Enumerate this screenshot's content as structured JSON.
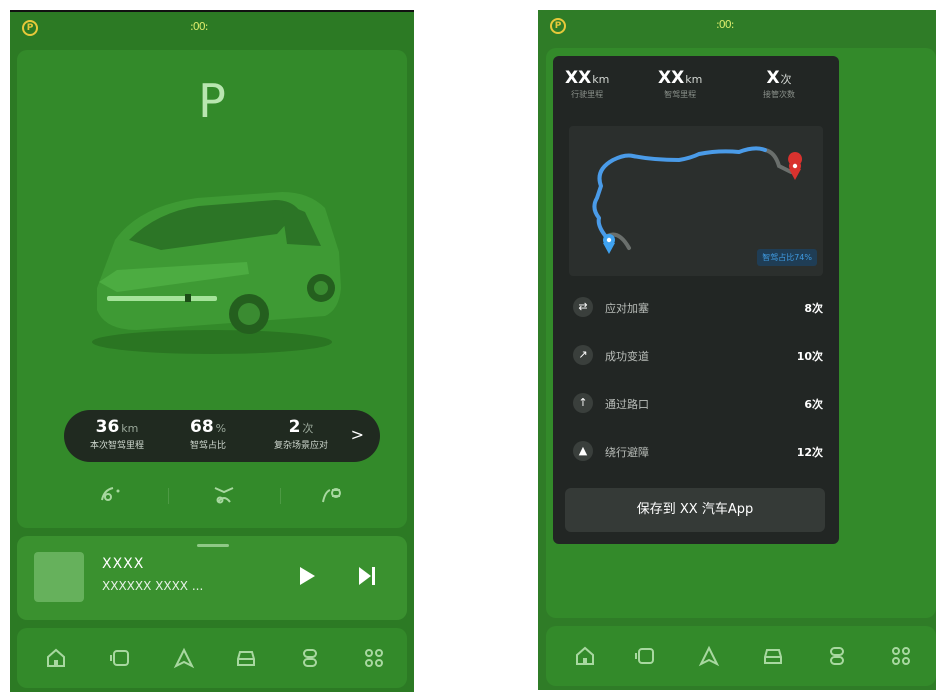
{
  "status": {
    "park_icon": "P",
    "light_icon": ":00:"
  },
  "left": {
    "gear": "P",
    "stats": [
      {
        "value": "36",
        "unit": "km",
        "label": "本次智驾里程"
      },
      {
        "value": "68",
        "unit": "%",
        "label": "智驾占比"
      },
      {
        "value": "2",
        "unit": "次",
        "label": "复杂场景应对"
      }
    ],
    "stats_chevron": ">",
    "features": [
      "steering-assist-icon",
      "auto-park-icon",
      "lane-assist-icon"
    ],
    "media": {
      "title": "XXXX",
      "subtitle": "XXXXXX XXXX ..."
    }
  },
  "dock": {
    "icons": [
      "home-icon",
      "media-icon",
      "navigation-icon",
      "car-icon",
      "control-icon",
      "apps-icon"
    ]
  },
  "right": {
    "top_stats": [
      {
        "value": "XX",
        "unit": "km",
        "label": "行驶里程"
      },
      {
        "value": "XX",
        "unit": "km",
        "label": "智驾里程"
      },
      {
        "value": "X",
        "unit": "次",
        "label": "接管次数"
      }
    ],
    "map": {
      "badge": "智驾占比74%",
      "smart_ratio": 0.74
    },
    "rows": [
      {
        "icon": "traffic-jam-icon",
        "label": "应对加塞",
        "value": "8次"
      },
      {
        "icon": "lane-change-icon",
        "label": "成功变道",
        "value": "10次"
      },
      {
        "icon": "intersection-icon",
        "label": "通过路口",
        "value": "6次"
      },
      {
        "icon": "obstacle-icon",
        "label": "绕行避障",
        "value": "12次"
      }
    ],
    "save_button": "保存到 XX 汽车App"
  },
  "colors": {
    "overlay_green": "#2c7a24",
    "route_blue": "#4a9be8",
    "end_pin": "#d9322e",
    "start_pin": "#3fa2f0"
  }
}
